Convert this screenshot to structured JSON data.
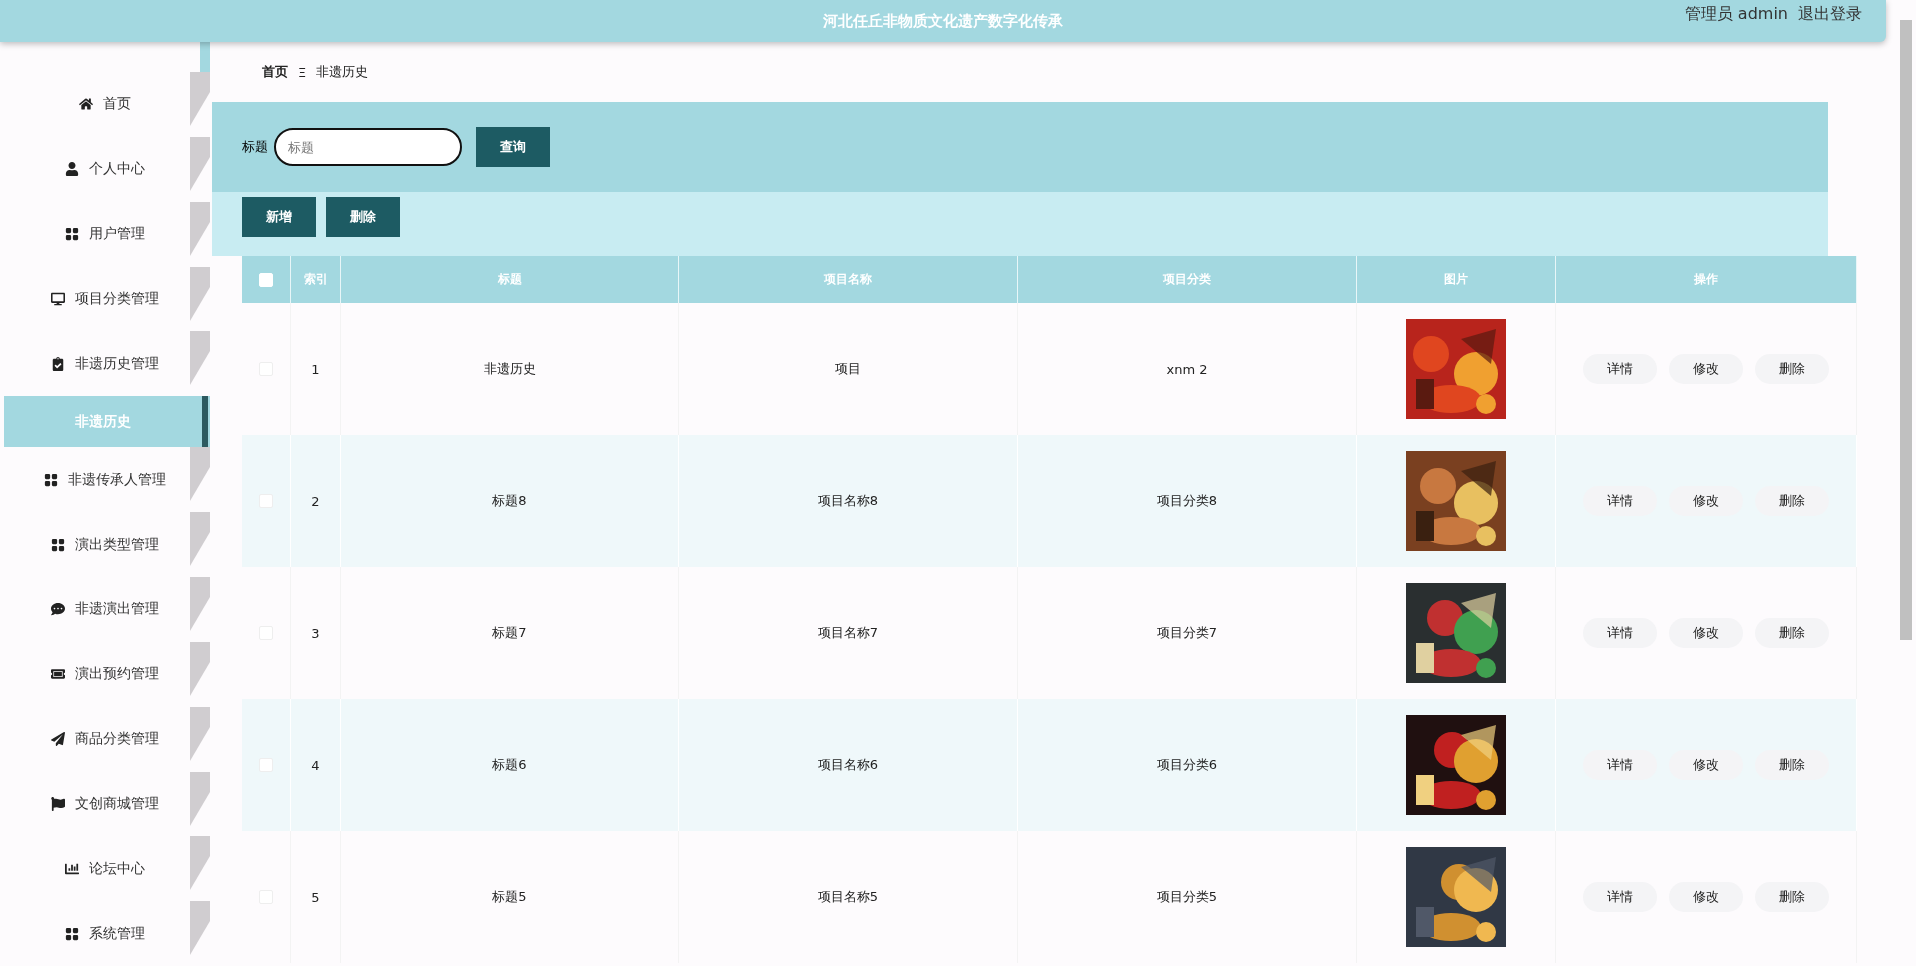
{
  "header": {
    "title": "河北任丘非物质文化遗产数字化传承",
    "user": "管理员 admin",
    "logout": "退出登录"
  },
  "sidebar": {
    "items": [
      {
        "label": "首页",
        "selected": false
      },
      {
        "label": "个人中心",
        "selected": false
      },
      {
        "label": "用户管理",
        "selected": false
      },
      {
        "label": "项目分类管理",
        "selected": false
      },
      {
        "label": "非遗历史管理",
        "selected": false
      },
      {
        "label": "非遗历史",
        "selected": true
      },
      {
        "label": "非遗传承人管理",
        "selected": false
      },
      {
        "label": "演出类型管理",
        "selected": false
      },
      {
        "label": "非遗演出管理",
        "selected": false
      },
      {
        "label": "演出预约管理",
        "selected": false
      },
      {
        "label": "商品分类管理",
        "selected": false
      },
      {
        "label": "文创商城管理",
        "selected": false
      },
      {
        "label": "论坛中心",
        "selected": false
      },
      {
        "label": "系统管理",
        "selected": false
      }
    ]
  },
  "breadcrumb": {
    "home": "首页",
    "separator": "Ξ",
    "current": "非遗历史"
  },
  "search": {
    "label": "标题",
    "placeholder": "标题",
    "button": "查询"
  },
  "actions": [
    "新增",
    "删除"
  ],
  "table": {
    "select_all": {
      "checked": false
    },
    "columns": [
      "索引",
      "标题",
      "项目名称",
      "项目分类",
      "图片",
      "操作"
    ],
    "rows": [
      {
        "index": "1",
        "title": "非遗历史",
        "name": "项目",
        "category": "xnm 2",
        "checked": false,
        "actions": [
          "详情",
          "修改",
          "删除"
        ]
      },
      {
        "index": "2",
        "title": "标题8",
        "name": "项目名称8",
        "category": "项目分类8",
        "checked": false,
        "actions": [
          "详情",
          "修改",
          "删除"
        ]
      },
      {
        "index": "3",
        "title": "标题7",
        "name": "项目名称7",
        "category": "项目分类7",
        "checked": false,
        "actions": [
          "详情",
          "修改",
          "删除"
        ]
      },
      {
        "index": "4",
        "title": "标题6",
        "name": "项目名称6",
        "category": "项目分类6",
        "checked": false,
        "actions": [
          "详情",
          "修改",
          "删除"
        ]
      },
      {
        "index": "5",
        "title": "标题5",
        "name": "项目名称5",
        "category": "项目分类5",
        "checked": false,
        "actions": [
          "详情",
          "修改",
          "删除"
        ]
      }
    ]
  }
}
